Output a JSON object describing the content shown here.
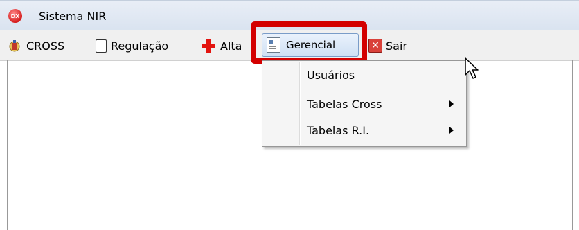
{
  "window": {
    "title": "Sistema NIR",
    "app_icon_text": "DX"
  },
  "menu": {
    "cross": "CROSS",
    "regulacao": "Regulação",
    "alta": "Alta",
    "gerencial": "Gerencial",
    "sair": "Sair"
  },
  "dropdown": {
    "items": [
      {
        "label": "Usuários",
        "has_submenu": false
      },
      {
        "label": "Tabelas Cross",
        "has_submenu": true
      },
      {
        "label": "Tabelas R.I.",
        "has_submenu": true
      }
    ]
  },
  "colors": {
    "highlight": "#d30000",
    "titlebar": "#dde6f2",
    "alta_cross": "#e3140f"
  }
}
